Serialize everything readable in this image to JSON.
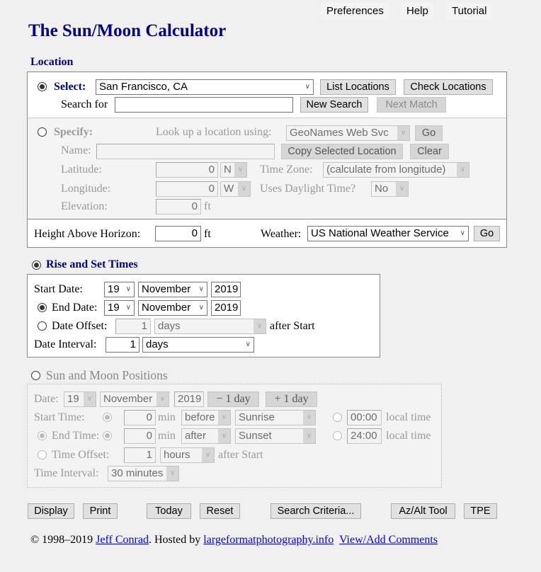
{
  "top_links": {
    "preferences": "Preferences",
    "help": "Help",
    "tutorial": "Tutorial"
  },
  "title": "The Sun/Moon Calculator",
  "location": {
    "heading": "Location",
    "select_label": "Select:",
    "selected_location": "San Francisco, CA",
    "list_locations": "List Locations",
    "check_locations": "Check Locations",
    "search_label": "Search for",
    "search_value": "",
    "new_search": "New Search",
    "next_match": "Next Match",
    "specify_label": "Specify:",
    "lookup_label": "Look up a location using:",
    "lookup_service": "GeoNames Web Svc",
    "go": "Go",
    "name_label": "Name:",
    "name_value": "",
    "copy_selected": "Copy Selected Location",
    "clear": "Clear",
    "latitude_label": "Latitude:",
    "latitude_value": "0",
    "latitude_dir": "N",
    "timezone_label": "Time Zone:",
    "timezone_value": "(calculate from longitude)",
    "longitude_label": "Longitude:",
    "longitude_value": "0",
    "longitude_dir": "W",
    "daylight_label": "Uses Daylight Time?",
    "daylight_value": "No",
    "elevation_label": "Elevation:",
    "elevation_value": "0",
    "elevation_unit": "ft",
    "height_label": "Height Above Horizon:",
    "height_value": "0",
    "height_unit": "ft",
    "weather_label": "Weather:",
    "weather_value": "US National Weather Service",
    "weather_go": "Go"
  },
  "rise_set": {
    "heading": "Rise and Set Times",
    "start_label": "Start Date:",
    "start_day": "19",
    "start_month": "November",
    "start_year": "2019",
    "end_label": "End Date:",
    "end_day": "19",
    "end_month": "November",
    "end_year": "2019",
    "offset_label": "Date Offset:",
    "offset_value": "1",
    "offset_unit": "days",
    "offset_suffix": "after Start",
    "interval_label": "Date Interval:",
    "interval_value": "1",
    "interval_unit": "days"
  },
  "positions": {
    "heading": "Sun and Moon Positions",
    "date_label": "Date:",
    "day": "19",
    "month": "November",
    "year": "2019",
    "minus_day": "− 1 day",
    "plus_day": "+ 1 day",
    "start_time_label": "Start Time:",
    "start_min": "0",
    "min_label": "min",
    "start_rel": "before",
    "start_event": "Sunrise",
    "start_local": "00:00",
    "local_time": "local time",
    "end_time_label": "End Time:",
    "end_min": "0",
    "end_rel": "after",
    "end_event": "Sunset",
    "end_local": "24:00",
    "time_offset_label": "Time Offset:",
    "time_offset_value": "1",
    "time_offset_unit": "hours",
    "after_start": "after Start",
    "time_interval_label": "Time Interval:",
    "time_interval_value": "30 minutes"
  },
  "actions": {
    "display": "Display",
    "print": "Print",
    "today": "Today",
    "reset": "Reset",
    "search_criteria": "Search Criteria...",
    "azalt": "Az/Alt Tool",
    "tpe": "TPE"
  },
  "footer": {
    "copyright": "© 1998–2019",
    "author": "Jeff Conrad",
    "hosted": ". Hosted by",
    "host": "largeformatphotography.info",
    "comments": "View/Add Comments"
  }
}
